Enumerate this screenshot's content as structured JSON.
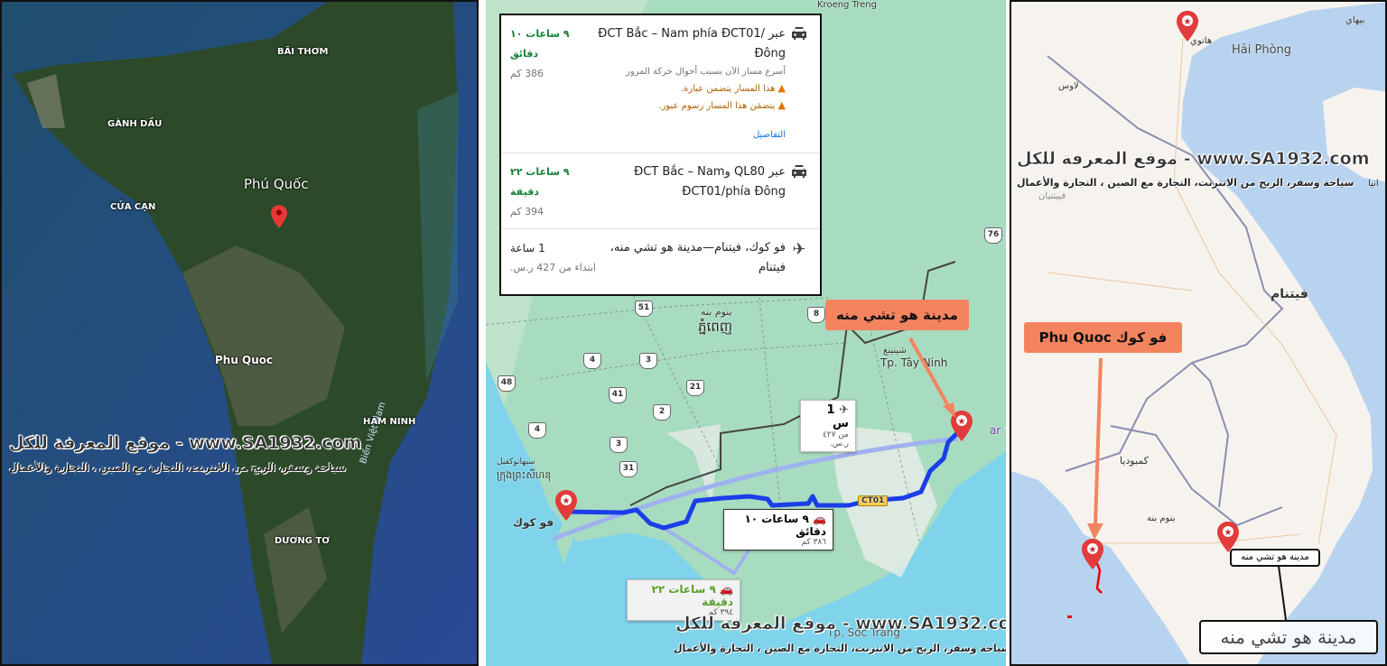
{
  "satellite_map": {
    "labels": {
      "bai_thom": "BÃI THƠM",
      "ganh_dau": "GÀNH DẦU",
      "phu_quoc_area": "Phú Quốc",
      "cua_can": "CỬA CẠN",
      "phu_quoc_town": "Phu Quoc",
      "ham_ninh": "HÀM NINH",
      "sea": "Biển Việt Nam",
      "duong_to": "DƯƠNG TƠ"
    },
    "pin_icon": "location-pin-icon"
  },
  "route_map": {
    "directions": [
      {
        "mode_icon": "car-icon",
        "via": "عبر ĐCT Bắc – Nam phía ĐCT01/Đông",
        "duration": "٩ ساعات ١٠ دقائق",
        "distance": "386 كم",
        "note": "أسرع مسار الآن بسبب أحوال حركة المرور",
        "warnings": [
          "هذا المسار يتضمن عبارة.",
          "يتضمَن هذا المسار رسوم عبور."
        ],
        "details_link": "التفاصيل"
      },
      {
        "mode_icon": "car-icon",
        "via": "عبر QL80 وĐCT Bắc – Nam ĐCT01/phía Đông",
        "duration": "٩ ساعات ٢٢ دقيقة",
        "distance": "394 كم"
      },
      {
        "mode_icon": "airplane-icon",
        "via": "فو كوك، فيتنام—مدينة هو تشي منه، فيتنام",
        "duration": "1 ساعة",
        "price": "ابتداء من 427 ر.س."
      }
    ],
    "shields": [
      "51",
      "8",
      "4",
      "3",
      "48",
      "41",
      "21",
      "2",
      "4",
      "3",
      "31",
      "76"
    ],
    "road_code": "CT01",
    "places": {
      "kroeng": "Kroeng Treng",
      "phnom_penh_ar": "بنوم بنه",
      "phnom_penh_km": "ភ្នំពេញ",
      "tay_ninh_ar": "شينينغ",
      "tay_ninh": "Tp. Tây Ninh",
      "sihanouk_ar": "سيهانوكفيل",
      "sihanouk_km": "ក្រុងព្រះសីហនុ",
      "phu_quoc": "فو كوك",
      "soc_trang": "Tp. Sóc Trăng",
      "partial": "ar"
    },
    "route_labels": {
      "flight_time": "1 س",
      "flight_price": "من ٤٢٧ ر.س.",
      "route1_time": "٩ ساعات ١٠ دقائق",
      "route1_dist": "٣٨٦ كم",
      "route2_time": "٩ ساعات ٢٢ دقيقة",
      "route2_dist": "٣٩٤ كم"
    },
    "callout": "مدينة هو تشي منه",
    "colors": {
      "route": "#1a3ee8",
      "alt_route": "#9fb2ee",
      "callout": "#f4845f",
      "pin": "#e23b3b"
    }
  },
  "region_map": {
    "places": {
      "beihai": "بيهاي",
      "hanoi": "هانوي",
      "hai_phong": "Hải Phòng",
      "laos": "لاوس",
      "vientiane": "فيينتيان",
      "hainan": "انيا",
      "vietnam": "فيتنام",
      "cambodia": "كمبوديا",
      "phnom_penh": "بنوم بنه"
    },
    "callout": "Phu Quoc فو كوك",
    "hcmc_small": "مدينة هو تشي منه",
    "hcmc_large": "مدينة هو تشي منه"
  },
  "watermark": {
    "line1": "موقع المعرفة للكل - www.SA1932.com",
    "line2": "سياحة وسفر، الربح من الانترنت، التجارة مع الصين ، التجارة والأعمال"
  }
}
